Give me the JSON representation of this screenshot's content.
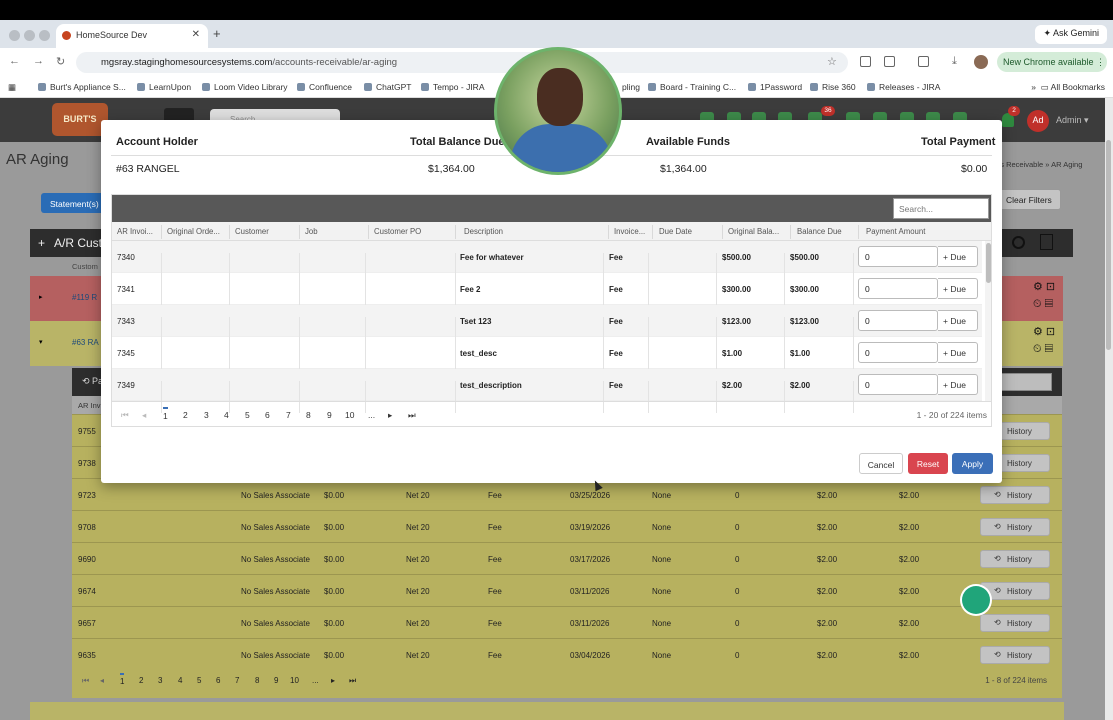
{
  "browser": {
    "tab_title": "HomeSource Dev",
    "url_host": "mgsray.staginghomesourcesystems.com",
    "url_path": "/accounts-receivable/ar-aging",
    "gemini_label": "Ask Gemini",
    "update_label": "New Chrome available",
    "bookmarks": [
      "Burt's Appliance S...",
      "LearnUpon",
      "Loom Video Library",
      "Confluence",
      "ChatGPT",
      "Tempo - JIRA",
      "pling",
      "Board - Training C...",
      "1Password",
      "Rise 360",
      "Releases - JIRA"
    ],
    "all_bookmarks": "All Bookmarks"
  },
  "app": {
    "logo_text": "BURT'S",
    "search_placeholder": "Search",
    "admin_initials": "Ad",
    "admin_label": "Admin",
    "notif_count": "2",
    "cart_count": "36",
    "page_title": "AR Aging",
    "breadcrumb": "nts Receivable  »  AR Aging",
    "statements_btn": "Statement(s)",
    "clear_filters": "Clear Filters",
    "section_title": "A/R Cust",
    "col_customer": "Custom",
    "red_row_id": "#119 R",
    "yel_row_id": "#63 RA",
    "sub_col_ar": "AR Inv",
    "sub_history": "History",
    "sub_rows": [
      {
        "id": "9755",
        "assoc": "",
        "amt": "",
        "terms": "",
        "type": "",
        "date": "",
        "none": "",
        "z": "",
        "d1": "",
        "d2": ""
      },
      {
        "id": "9738",
        "assoc": "",
        "amt": "",
        "terms": "",
        "type": "",
        "date": "",
        "none": "",
        "z": "",
        "d1": "",
        "d2": ""
      },
      {
        "id": "9723",
        "assoc": "No Sales Associate",
        "amt": "$0.00",
        "terms": "Net 20",
        "type": "Fee",
        "date": "03/25/2026",
        "none": "None",
        "z": "0",
        "d1": "$2.00",
        "d2": "$2.00"
      },
      {
        "id": "9708",
        "assoc": "No Sales Associate",
        "amt": "$0.00",
        "terms": "Net 20",
        "type": "Fee",
        "date": "03/19/2026",
        "none": "None",
        "z": "0",
        "d1": "$2.00",
        "d2": "$2.00"
      },
      {
        "id": "9690",
        "assoc": "No Sales Associate",
        "amt": "$0.00",
        "terms": "Net 20",
        "type": "Fee",
        "date": "03/17/2026",
        "none": "None",
        "z": "0",
        "d1": "$2.00",
        "d2": "$2.00"
      },
      {
        "id": "9674",
        "assoc": "No Sales Associate",
        "amt": "$0.00",
        "terms": "Net 20",
        "type": "Fee",
        "date": "03/11/2026",
        "none": "None",
        "z": "0",
        "d1": "$2.00",
        "d2": "$2.00"
      },
      {
        "id": "9657",
        "assoc": "No Sales Associate",
        "amt": "$0.00",
        "terms": "Net 20",
        "type": "Fee",
        "date": "03/11/2026",
        "none": "None",
        "z": "0",
        "d1": "$2.00",
        "d2": "$2.00"
      },
      {
        "id": "9635",
        "assoc": "No Sales Associate",
        "amt": "$0.00",
        "terms": "Net 20",
        "type": "Fee",
        "date": "03/04/2026",
        "none": "None",
        "z": "0",
        "d1": "$2.00",
        "d2": "$2.00"
      }
    ],
    "sub_pages": [
      "1",
      "2",
      "3",
      "4",
      "5",
      "6",
      "7",
      "8",
      "9",
      "10",
      "..."
    ],
    "sub_page_info": "1 - 8 of 224 items"
  },
  "modal": {
    "headers": {
      "holder": "Account Holder",
      "balance": "Total Balance Due",
      "funds": "Available Funds",
      "payment": "Total Payment"
    },
    "values": {
      "holder": "#63 RANGEL",
      "balance": "$1,364.00",
      "funds": "$1,364.00",
      "payment": "$0.00"
    },
    "search_placeholder": "Search...",
    "columns": [
      "AR Invoi...",
      "Original Orde...",
      "Customer",
      "Job",
      "Customer PO",
      "Description",
      "Invoice...",
      "Due Date",
      "Original Bala...",
      "Balance Due",
      "Payment Amount"
    ],
    "rows": [
      {
        "inv": "7340",
        "desc": "Fee for whatever",
        "type": "Fee",
        "orig": "$500.00",
        "bal": "$500.00",
        "pay": "0"
      },
      {
        "inv": "7341",
        "desc": "Fee 2",
        "type": "Fee",
        "orig": "$300.00",
        "bal": "$300.00",
        "pay": "0"
      },
      {
        "inv": "7343",
        "desc": "Tset 123",
        "type": "Fee",
        "orig": "$123.00",
        "bal": "$123.00",
        "pay": "0"
      },
      {
        "inv": "7345",
        "desc": "test_desc",
        "type": "Fee",
        "orig": "$1.00",
        "bal": "$1.00",
        "pay": "0"
      },
      {
        "inv": "7349",
        "desc": "test_description",
        "type": "Fee",
        "orig": "$2.00",
        "bal": "$2.00",
        "pay": "0"
      }
    ],
    "due_label": "+ Due",
    "pages": [
      "1",
      "2",
      "3",
      "4",
      "5",
      "6",
      "7",
      "8",
      "9",
      "10",
      "..."
    ],
    "page_info": "1 - 20 of 224 items",
    "cancel": "Cancel",
    "reset": "Reset",
    "apply": "Apply"
  }
}
